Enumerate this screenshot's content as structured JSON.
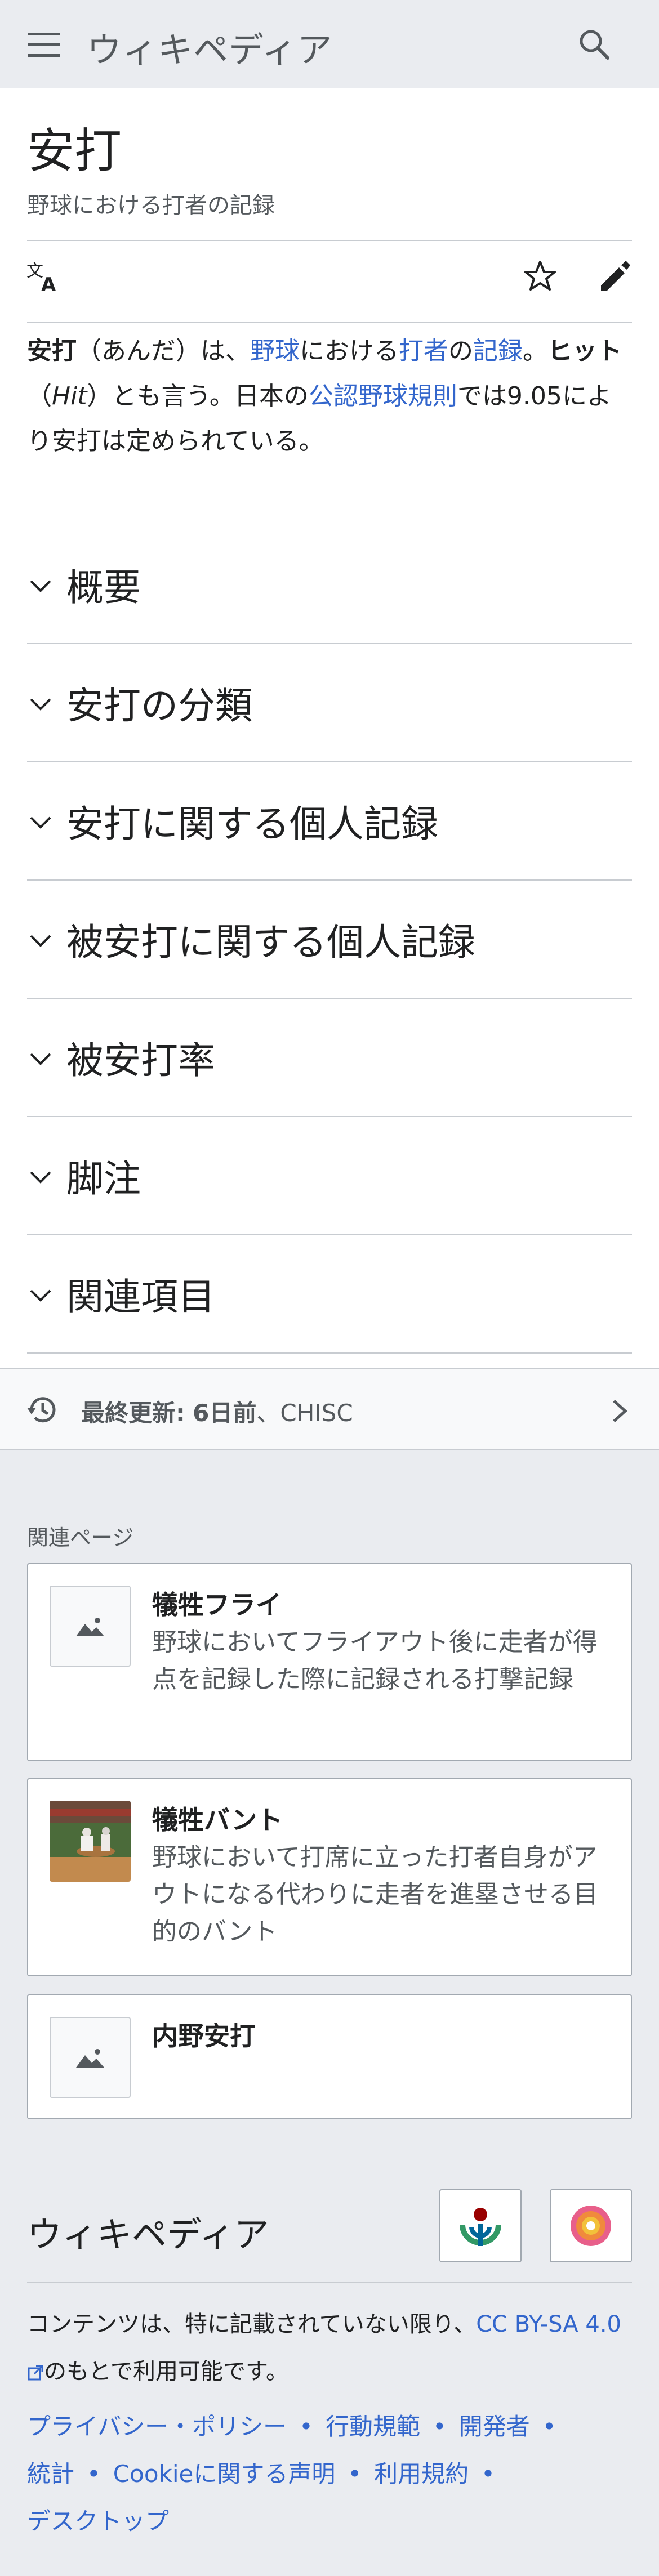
{
  "header": {
    "site_title": "ウィキペディア",
    "menu_icon": "hamburger-icon",
    "search_icon": "search-icon"
  },
  "article": {
    "title": "安打",
    "description": "野球における打者の記録",
    "actions": {
      "language_icon": "translate-icon",
      "watch_icon": "star-icon",
      "edit_icon": "pencil-icon"
    },
    "lead": {
      "term": "安打",
      "reading": "（あんだ）は、",
      "link_baseball": "野球",
      "text1": "における",
      "link_batter": "打者",
      "text2": "の",
      "link_record": "記録",
      "text3": "。",
      "alt_term": "ヒット",
      "alt_open": "（",
      "alt_en": "Hit",
      "alt_close": "）とも言う。日本の",
      "link_rules": "公認野球規則",
      "text4": "では9.05により安打は定められている。"
    },
    "sections": [
      "概要",
      "安打の分類",
      "安打に関する個人記録",
      "被安打に関する個人記録",
      "被安打率",
      "脚注",
      "関連項目"
    ]
  },
  "last_modified": {
    "label": "最終更新:",
    "ago": "6日前",
    "editor": "、CHISC"
  },
  "related": {
    "heading": "関連ページ",
    "items": [
      {
        "title": "犠牲フライ",
        "description": "野球においてフライアウト後に走者が得点を記録した際に記録される打撃記録",
        "thumbnail": "image-placeholder-icon"
      },
      {
        "title": "犠牲バント",
        "description": "野球において打席に立った打者自身がアウトになる代わりに走者を進塁させる目的のバント",
        "thumbnail": "baseball-photo"
      },
      {
        "title": "内野安打",
        "description": "",
        "thumbnail": "image-placeholder-icon"
      }
    ]
  },
  "footer": {
    "title": "ウィキペディア",
    "license_text1": "コンテンツは、特に記載されていない限り、",
    "license_link": "CC BY-SA 4.0",
    "license_text2": "のもとで利用可能です。",
    "links": [
      "プライバシー・ポリシー",
      "行動規範",
      "開発者",
      "統計",
      "Cookieに関する声明",
      "利用規約",
      "デスクトップ"
    ]
  },
  "colors": {
    "link": "#3366cc",
    "chrome_bg": "#eaecf0",
    "border": "#c8ccd1",
    "muted_text": "#54595d"
  }
}
